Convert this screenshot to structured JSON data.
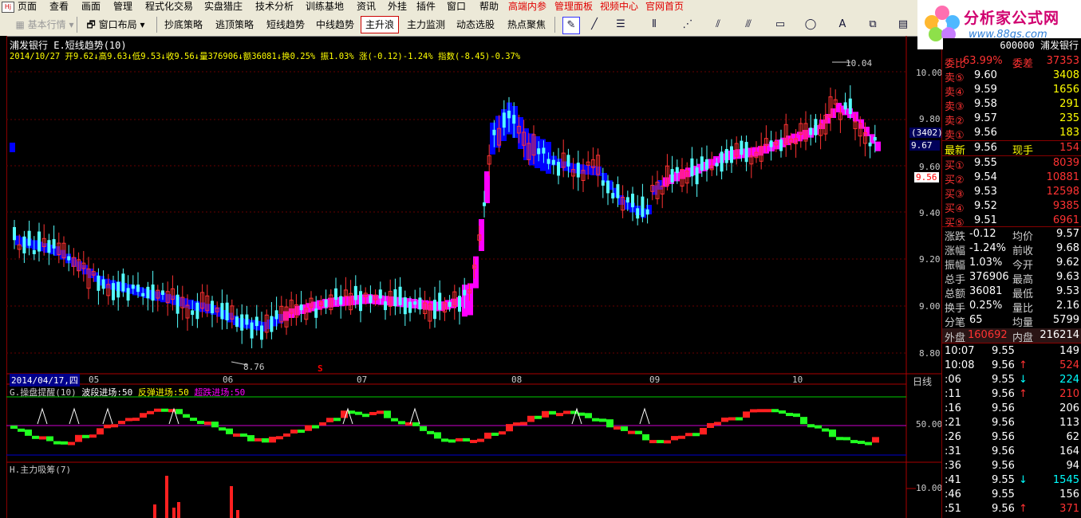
{
  "menu": {
    "items": [
      "页面",
      "查看",
      "画面",
      "管理",
      "程式化交易",
      "实盘猎庄",
      "技术分析",
      "训练基地",
      "资讯",
      "外挂",
      "插件",
      "窗口",
      "帮助"
    ],
    "hot_items": [
      "高端内参",
      "管理面板",
      "视频中心",
      "官网首页"
    ]
  },
  "toolbar": {
    "basic_quote": "基本行情",
    "window_layout": "窗口布局",
    "strategies": [
      "抄底策略",
      "逃顶策略",
      "短线趋势",
      "中线趋势",
      "主升浪",
      "主力监测",
      "动态选股",
      "热点聚焦"
    ],
    "active_strategy": "主升浪"
  },
  "brand": {
    "name": "分析家公式网",
    "url": "www.88gs.com"
  },
  "main_chart": {
    "stock_name": "浦发银行",
    "indicator": "E.短线趋势(10)",
    "info_line": "2014/10/27 开9.62↓高9.63↓低9.53↓收9.56↓量376906↓额36081↓换0.25% 振1.03% 涨(-0.12)-1.24% 指数(-8.45)-0.37%",
    "price_ticks": [
      "10.00",
      "9.80",
      "9.60",
      "9.40",
      "9.20",
      "9.00",
      "8.80"
    ],
    "high_label": "10.04",
    "low_label": "8.76",
    "cursor_volume": "(3402)",
    "cursor_price": "9.67",
    "last_price": "9.56",
    "s_marker": "S",
    "x_labels": [
      "2014/04/17,四",
      "05",
      "06",
      "07",
      "08",
      "09",
      "10"
    ],
    "cycle": "日线"
  },
  "sub_chart_1": {
    "title": "G.操盘提醒(10)",
    "legend": [
      "波段进场:50",
      "反弹进场:50",
      "超跌进场:50"
    ],
    "tick": "50.00"
  },
  "sub_chart_2": {
    "title": "H.主力吸筹(7)",
    "tick": "10.00"
  },
  "quote_panel": {
    "code_name": "600000 浦发银行",
    "commission_ratio_label": "委比",
    "commission_ratio": "63.99%",
    "commission_diff_label": "委差",
    "commission_diff": "37353",
    "sell_levels": [
      {
        "label": "卖⑤",
        "price": "9.60",
        "vol": "3408"
      },
      {
        "label": "卖④",
        "price": "9.59",
        "vol": "1656"
      },
      {
        "label": "卖③",
        "price": "9.58",
        "vol": "291"
      },
      {
        "label": "卖②",
        "price": "9.57",
        "vol": "235"
      },
      {
        "label": "卖①",
        "price": "9.56",
        "vol": "183"
      }
    ],
    "latest_label": "最新",
    "latest": "9.56",
    "current_hand_label": "现手",
    "current_hand": "154",
    "buy_levels": [
      {
        "label": "买①",
        "price": "9.55",
        "vol": "8039"
      },
      {
        "label": "买②",
        "price": "9.54",
        "vol": "10881"
      },
      {
        "label": "买③",
        "price": "9.53",
        "vol": "12598"
      },
      {
        "label": "买④",
        "price": "9.52",
        "vol": "9385"
      },
      {
        "label": "买⑤",
        "price": "9.51",
        "vol": "6961"
      }
    ],
    "stats": [
      {
        "l1": "涨跌",
        "v1": "-0.12",
        "l2": "均价",
        "v2": "9.57"
      },
      {
        "l1": "涨幅",
        "v1": "-1.24%",
        "l2": "前收",
        "v2": "9.68"
      },
      {
        "l1": "振幅",
        "v1": "1.03%",
        "l2": "今开",
        "v2": "9.62"
      },
      {
        "l1": "总手",
        "v1": "376906",
        "l2": "最高",
        "v2": "9.63"
      },
      {
        "l1": "总额",
        "v1": "36081",
        "l2": "最低",
        "v2": "9.53"
      },
      {
        "l1": "换手",
        "v1": "0.25%",
        "l2": "量比",
        "v2": "2.16"
      },
      {
        "l1": "分笔",
        "v1": "65",
        "l2": "均量",
        "v2": "5799"
      }
    ],
    "outer_label": "外盘",
    "outer": "160692",
    "inner_label": "内盘",
    "inner": "216214",
    "ticks": [
      {
        "t": "10:07",
        "p": "9.55",
        "a": "",
        "v": "149"
      },
      {
        "t": "10:08",
        "p": "9.56",
        "a": "↑",
        "v": "524"
      },
      {
        "t": ":06",
        "p": "9.55",
        "a": "↓",
        "v": "224"
      },
      {
        "t": ":11",
        "p": "9.56",
        "a": "↑",
        "v": "210"
      },
      {
        "t": ":16",
        "p": "9.56",
        "a": "",
        "v": "206"
      },
      {
        "t": ":21",
        "p": "9.56",
        "a": "",
        "v": "113"
      },
      {
        "t": ":26",
        "p": "9.56",
        "a": "",
        "v": "62"
      },
      {
        "t": ":31",
        "p": "9.56",
        "a": "",
        "v": "164"
      },
      {
        "t": ":36",
        "p": "9.56",
        "a": "",
        "v": "94"
      },
      {
        "t": ":41",
        "p": "9.55",
        "a": "↓",
        "v": "1545"
      },
      {
        "t": ":46",
        "p": "9.55",
        "a": "",
        "v": "156"
      },
      {
        "t": ":51",
        "p": "9.56",
        "a": "↑",
        "v": "371"
      }
    ]
  },
  "colors": {
    "up": "#ff3232",
    "down": "#54ffff",
    "trend_up": "#ff00ff",
    "trend_down": "#0000ff",
    "text_yellow": "#ffff00"
  }
}
